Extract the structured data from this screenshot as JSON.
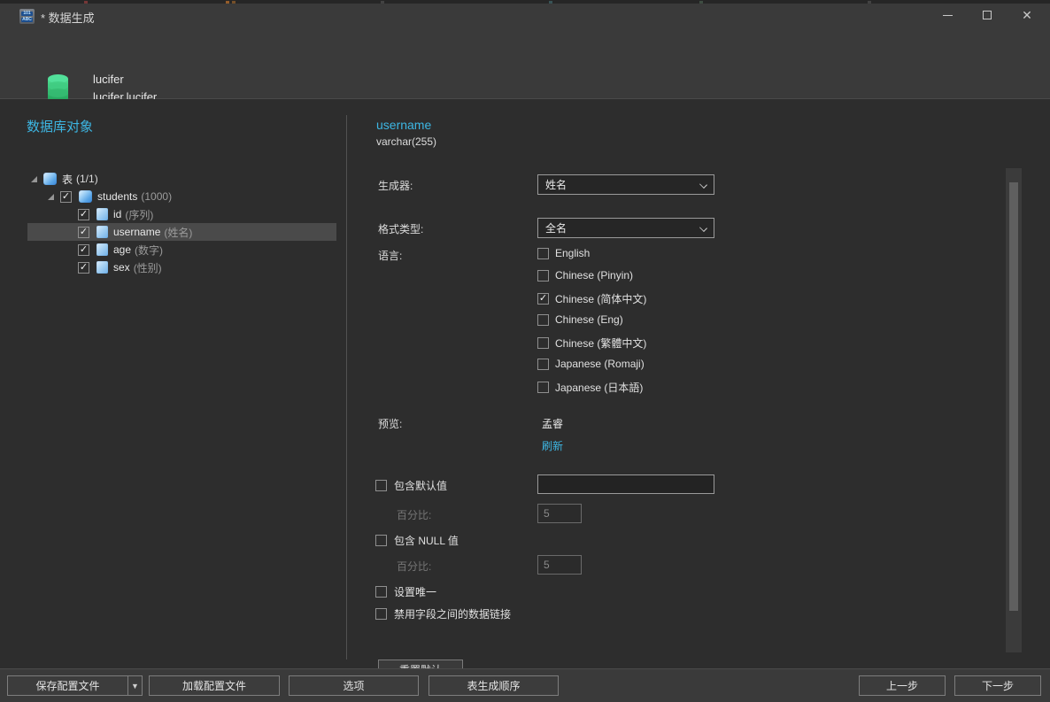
{
  "titlebar": {
    "title": "* 数据生成",
    "icon_line1": "101",
    "icon_line2": "ABC"
  },
  "header": {
    "connection": "lucifer",
    "database": "lucifer.lucifer"
  },
  "left_panel": {
    "title": "数据库对象",
    "tree": [
      {
        "label": "表",
        "suffix": "(1/1)"
      },
      {
        "label": "students",
        "suffix": "(1000)",
        "checked": true
      },
      {
        "label": "id",
        "suffix": "(序列)",
        "checked": true
      },
      {
        "label": "username",
        "suffix": "(姓名)",
        "checked": true,
        "selected": true
      },
      {
        "label": "age",
        "suffix": "(数字)",
        "checked": true
      },
      {
        "label": "sex",
        "suffix": "(性别)",
        "checked": true
      }
    ]
  },
  "field_panel": {
    "name": "username",
    "type": "varchar(255)",
    "generator_label": "生成器:",
    "generator_value": "姓名",
    "format_label": "格式类型:",
    "format_value": "全名",
    "language_label": "语言:",
    "languages": [
      {
        "label": "English",
        "checked": false
      },
      {
        "label": "Chinese (Pinyin)",
        "checked": false
      },
      {
        "label": "Chinese (简体中文)",
        "checked": true
      },
      {
        "label": "Chinese (Eng)",
        "checked": false
      },
      {
        "label": "Chinese (繁體中文)",
        "checked": false
      },
      {
        "label": "Japanese (Romaji)",
        "checked": false
      },
      {
        "label": "Japanese (日本語)",
        "checked": false
      }
    ],
    "preview_label": "预览:",
    "preview_value": "孟睿",
    "refresh_link": "刷新",
    "include_default_label": "包含默认值",
    "default_percent_label": "百分比:",
    "default_percent_value": "5",
    "default_value": "",
    "include_null_label": "包含 NULL 值",
    "null_percent_label": "百分比:",
    "null_percent_value": "5",
    "unique_label": "设置唯一",
    "disable_link_label": "禁用字段之间的数据链接",
    "partial_button_label": "重置默认"
  },
  "bottombar": {
    "save_profile": "保存配置文件",
    "load_profile": "加载配置文件",
    "options": "选项",
    "table_order": "表生成顺序",
    "previous": "上一步",
    "next": "下一步"
  },
  "colors": {
    "accent": "#3db7e4",
    "db_icon": "#35c776",
    "table_icon": "#58a4e6"
  }
}
